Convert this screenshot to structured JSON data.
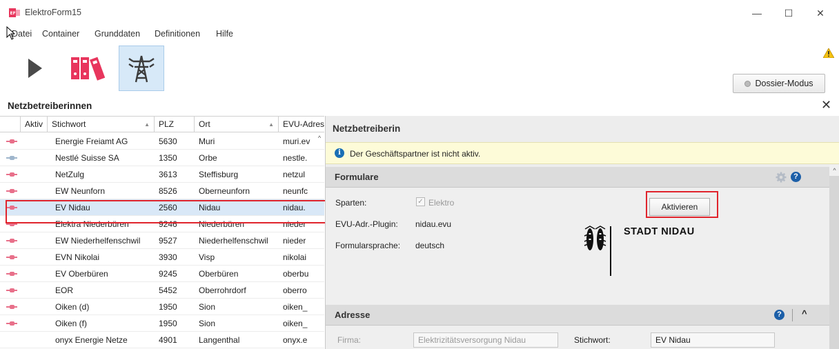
{
  "window": {
    "title": "ElektroForm15",
    "minimize": "—",
    "maximize": "☐",
    "close": "✕"
  },
  "menu": {
    "items": [
      "Datei",
      "Container",
      "Grunddaten",
      "Definitionen",
      "Hilfe"
    ]
  },
  "toolbar": {
    "dossier_label": "Dossier-Modus"
  },
  "list": {
    "title": "Netzbetreiberinnen",
    "columns": [
      "Aktiv",
      "Stichwort",
      "PLZ",
      "Ort",
      "EVU-Adres"
    ],
    "rows": [
      {
        "name": "Energie Freiamt AG",
        "plz": "5630",
        "ort": "Muri",
        "evu": "muri.ev"
      },
      {
        "name": "Nestlé Suisse SA",
        "plz": "1350",
        "ort": "Orbe",
        "evu": "nestle."
      },
      {
        "name": "NetZulg",
        "plz": "3613",
        "ort": "Steffisburg",
        "evu": "netzul"
      },
      {
        "name": "EW Neunforn",
        "plz": "8526",
        "ort": "Oberneunforn",
        "evu": "neunfc"
      },
      {
        "name": "EV Nidau",
        "plz": "2560",
        "ort": "Nidau",
        "evu": "nidau."
      },
      {
        "name": "Elektra Niederbüren",
        "plz": "9246",
        "ort": "Niederbüren",
        "evu": "nieder"
      },
      {
        "name": "EW Niederhelfenschwil",
        "plz": "9527",
        "ort": "Niederhelfenschwil",
        "evu": "nieder"
      },
      {
        "name": "EVN Nikolai",
        "plz": "3930",
        "ort": "Visp",
        "evu": "nikolai"
      },
      {
        "name": "EV Oberbüren",
        "plz": "9245",
        "ort": "Oberbüren",
        "evu": "oberbu"
      },
      {
        "name": "EOR",
        "plz": "5452",
        "ort": "Oberrohrdorf",
        "evu": "oberro"
      },
      {
        "name": "Oiken (d)",
        "plz": "1950",
        "ort": "Sion",
        "evu": "oiken_"
      },
      {
        "name": "Oiken (f)",
        "plz": "1950",
        "ort": "Sion",
        "evu": "oiken_"
      },
      {
        "name": "onyx Energie Netze",
        "plz": "4901",
        "ort": "Langenthal",
        "evu": "onyx.e"
      }
    ]
  },
  "detail": {
    "title": "Netzbetreiberin",
    "info": "Der Geschäftspartner ist nicht aktiv.",
    "formulare": {
      "title": "Formulare",
      "sparten_label": "Sparten:",
      "sparten_value": "Elektro",
      "plugin_label": "EVU-Adr.-Plugin:",
      "plugin_value": "nidau.evu",
      "sprache_label": "Formularsprache:",
      "sprache_value": "deutsch",
      "aktivieren": "Aktivieren",
      "logo_text": "STADT NIDAU"
    },
    "adresse": {
      "title": "Adresse",
      "firma_label": "Firma:",
      "firma_value": "Elektrizitätsversorgung Nidau",
      "stichwort_label": "Stichwort:",
      "stichwort_value": "EV Nidau"
    }
  }
}
